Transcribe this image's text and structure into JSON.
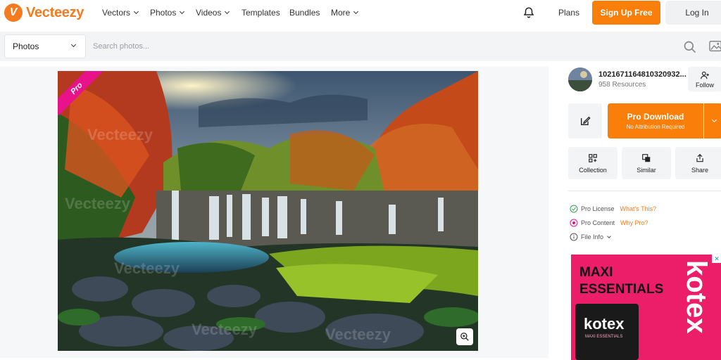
{
  "brand": {
    "name": "Vecteezy",
    "mark": "V"
  },
  "nav": {
    "items": [
      {
        "label": "Vectors",
        "dropdown": true
      },
      {
        "label": "Photos",
        "dropdown": true
      },
      {
        "label": "Videos",
        "dropdown": true
      },
      {
        "label": "Templates",
        "dropdown": false
      },
      {
        "label": "Bundles",
        "dropdown": false
      },
      {
        "label": "More",
        "dropdown": true
      }
    ],
    "plans": "Plans",
    "signup": "Sign Up Free",
    "login": "Log In"
  },
  "search": {
    "type": "Photos",
    "placeholder": "Search photos..."
  },
  "photo": {
    "badge": "Pro",
    "watermark": "Vecteezy"
  },
  "author": {
    "name": "1021671164810320932...",
    "resources": "958 Resources",
    "follow": "Follow"
  },
  "download": {
    "label": "Pro Download",
    "sub": "No Attribution Required"
  },
  "actions": [
    {
      "label": "Collection",
      "icon": "collection-icon"
    },
    {
      "label": "Similar",
      "icon": "similar-icon"
    },
    {
      "label": "Share",
      "icon": "share-icon"
    }
  ],
  "info": {
    "license_label": "Pro License",
    "license_link": "What's This?",
    "content_label": "Pro Content",
    "content_link": "Why Pro?",
    "file_info": "File Info"
  },
  "ad": {
    "title_line1": "MAXI",
    "title_line2": "ESSENTIALS",
    "brand": "kotex",
    "pack_logo": "kotex",
    "pack_sub": "MAXI ESSENTIALS"
  },
  "colors": {
    "accent": "#fa7f0a",
    "pro_badge": "#e8128a",
    "ad_bg": "#ec1e6a"
  }
}
